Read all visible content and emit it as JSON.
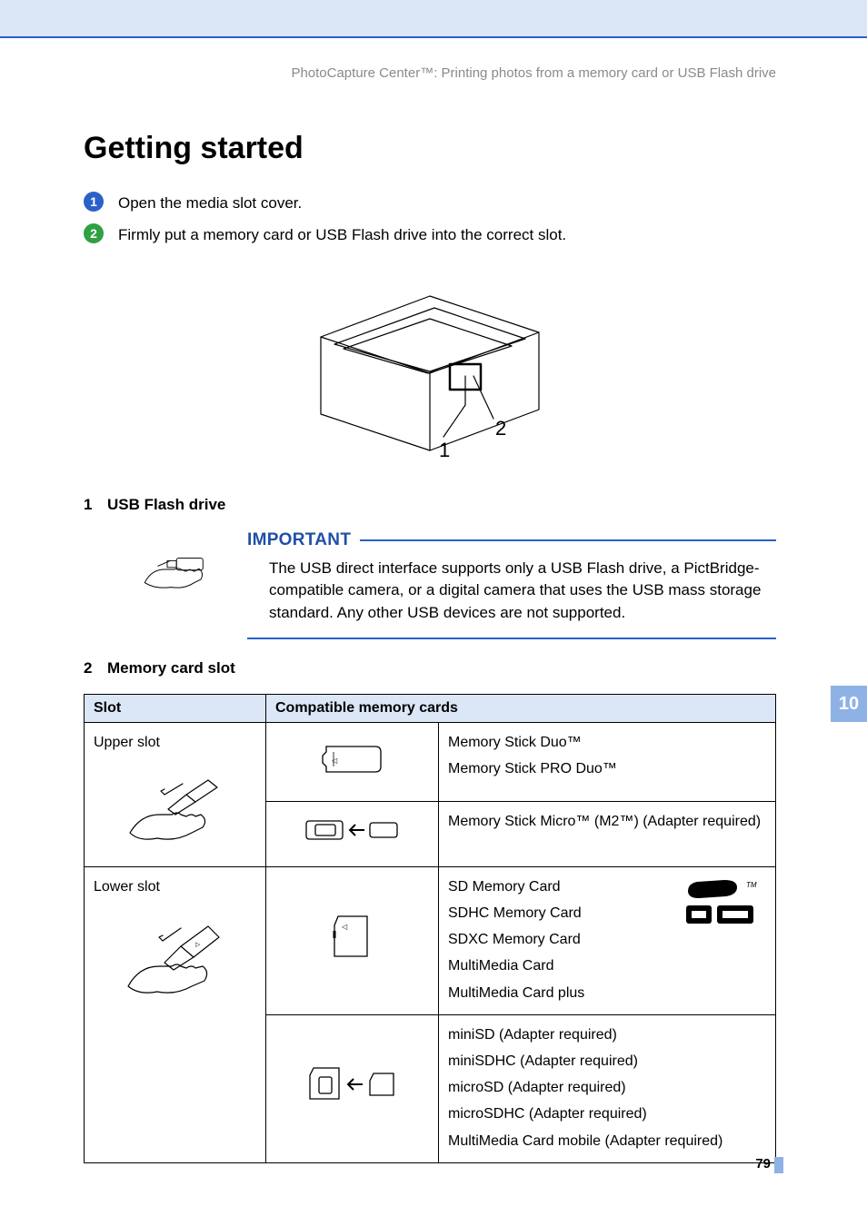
{
  "header": {
    "context": "PhotoCapture Center™: Printing photos from a memory card or USB Flash drive"
  },
  "title": "Getting started",
  "steps": [
    {
      "n": "1",
      "text": "Open the media slot cover."
    },
    {
      "n": "2",
      "text": "Firmly put a memory card or USB Flash drive into the correct slot."
    }
  ],
  "figure_labels": {
    "one": "1",
    "two": "2"
  },
  "legend": {
    "usb": {
      "n": "1",
      "label": "USB Flash drive"
    },
    "mem": {
      "n": "2",
      "label": "Memory card slot"
    }
  },
  "important": {
    "title": "IMPORTANT",
    "text": "The USB direct interface supports only a USB Flash drive, a PictBridge-compatible camera, or a digital camera that uses the USB mass storage standard. Any other USB devices are not supported."
  },
  "chart_data": {
    "type": "table",
    "headers": {
      "slot": "Slot",
      "cards": "Compatible memory cards"
    },
    "rows": [
      {
        "slot": "Upper slot",
        "groups": [
          {
            "icon": "memory-stick-duo-icon",
            "cards": [
              "Memory Stick Duo™",
              "Memory Stick PRO Duo™"
            ]
          },
          {
            "icon": "memory-stick-micro-adapter-icon",
            "cards": [
              "Memory Stick Micro™ (M2™) (Adapter required)"
            ]
          }
        ]
      },
      {
        "slot": "Lower slot",
        "groups": [
          {
            "icon": "sd-card-icon",
            "logo": "sdhc-logo",
            "cards": [
              "SD Memory Card",
              "SDHC Memory Card",
              "SDXC Memory Card",
              "MultiMedia Card",
              "MultiMedia Card plus"
            ]
          },
          {
            "icon": "sd-adapter-icon",
            "cards": [
              "miniSD (Adapter required)",
              "miniSDHC (Adapter required)",
              "microSD (Adapter required)",
              "microSDHC (Adapter required)",
              "MultiMedia Card mobile (Adapter required)"
            ]
          }
        ]
      }
    ]
  },
  "side_tab": "10",
  "page_number": "79"
}
